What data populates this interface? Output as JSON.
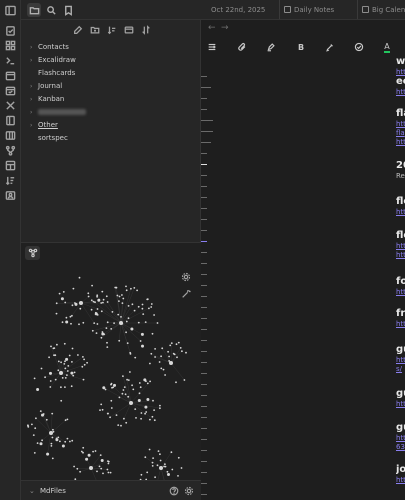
{
  "ribbon": {
    "icons": [
      "sidebar-toggle-icon",
      "tasks-icon",
      "grid-icon",
      "terminal-icon",
      "calendar-icon",
      "calendar-check-icon",
      "kanban-board-icon",
      "tools-icon",
      "book-icon",
      "git-branch-icon",
      "layout-icon",
      "sort-icon",
      "user-card-icon"
    ]
  },
  "sidebar": {
    "files": [
      {
        "label": "Contacts",
        "collapsible": true
      },
      {
        "label": "Excalidraw",
        "collapsible": true
      },
      {
        "label": "Flashcards",
        "collapsible": false
      },
      {
        "label": "Journal",
        "collapsible": true
      },
      {
        "label": "Kanban",
        "collapsible": true
      },
      {
        "label": "",
        "collapsible": true,
        "redacted": true
      },
      {
        "label": "Other",
        "collapsible": true,
        "underline": true
      },
      {
        "label": "sortspec",
        "collapsible": false
      }
    ],
    "vault_name": "MdFiles"
  },
  "tabs": [
    {
      "label": "Oct 22nd, 2025"
    },
    {
      "label": "Daily Notes"
    },
    {
      "label": "Big Calendar"
    }
  ],
  "nav": {
    "back": "←",
    "forward": "→"
  },
  "toolbar": {
    "bold": "B",
    "text_color": "A",
    "text_color_accent": "#22c55e"
  },
  "content": {
    "entries": [
      {
        "heading": "wi",
        "link": "htt"
      },
      {
        "heading": "ec",
        "link": "htt"
      },
      {
        "heading": "fla",
        "links": [
          "htt",
          "fla",
          "htt"
        ]
      },
      {
        "heading": "20",
        "text": "Re"
      },
      {
        "heading": "fle",
        "link": "htt"
      },
      {
        "heading": "fle",
        "links": [
          "htt",
          "htt"
        ]
      },
      {
        "heading": "fo",
        "link": "htt"
      },
      {
        "heading": "fre",
        "link": "htt"
      },
      {
        "heading": "gu",
        "links": [
          "htt",
          "s/"
        ]
      },
      {
        "heading": "gu",
        "link": "htt"
      },
      {
        "heading": "gu",
        "links": [
          "htt",
          "63"
        ]
      },
      {
        "heading": "jo",
        "link": "htt"
      }
    ]
  },
  "colors": {
    "link": "#8a7ff0",
    "background": "#1e1e1e",
    "panel": "#262626"
  }
}
